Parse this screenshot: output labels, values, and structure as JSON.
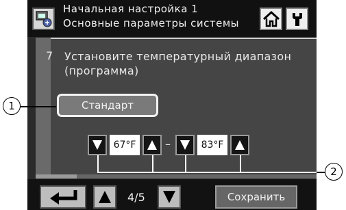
{
  "header": {
    "line1": "Начальная настройка 1",
    "line2": "Основные параметры системы",
    "icons": [
      "remote-controller-icon",
      "home-icon",
      "wrench-icon"
    ]
  },
  "step": {
    "number": "7",
    "line1": "Установите температурный диапазон",
    "line2": "(программа)"
  },
  "program_button": "Стандарт",
  "range": {
    "low": "67°F",
    "separator": "–",
    "high": "83°F"
  },
  "footer": {
    "page": "4/5",
    "save_label": "Сохранить"
  },
  "callouts": {
    "one": "1",
    "two": "2"
  },
  "colors": {
    "screen_bg": "#2b2b2b",
    "panel_bg": "#454545",
    "button_bg": "#7a7a7a"
  }
}
